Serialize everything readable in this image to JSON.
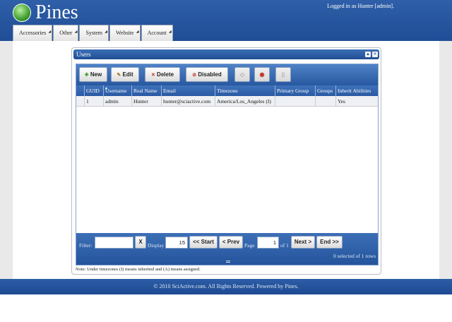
{
  "app": {
    "name": "Pines",
    "login_text": "Logged in as Hunter [admin]."
  },
  "menu": [
    {
      "label": "Accessories"
    },
    {
      "label": "Other"
    },
    {
      "label": "System"
    },
    {
      "label": "Website"
    },
    {
      "label": "Account"
    }
  ],
  "window": {
    "title": "Users"
  },
  "toolbar": {
    "new_label": "New",
    "edit_label": "Edit",
    "delete_label": "Delete",
    "disabled_label": "Disabled"
  },
  "table": {
    "columns": [
      "",
      "GUID",
      "Username",
      "Real Name",
      "Email",
      "Timezone",
      "Primary Group",
      "Groups",
      "Inherit Abilities"
    ],
    "rows": [
      [
        "",
        "1",
        "admin",
        "Hunter",
        "hunter@sciactive.com",
        "America/Los_Angeles (I)",
        "",
        "",
        "Yes"
      ]
    ]
  },
  "pager": {
    "filter_label": "Filter:",
    "filter_value": "",
    "clear_label": "X",
    "display_label": "Display",
    "display_value": "15",
    "start_label": "<< Start",
    "prev_label": "< Prev",
    "page_label": "Page",
    "page_value": "1",
    "of_label": "of 1",
    "next_label": "Next >",
    "end_label": "End >>",
    "status_text": "0 selected of 1 rows"
  },
  "note": "Note: Under timezones (I) means inherited and (A) means assigned.",
  "footer": {
    "text": "© 2010 SciActive.com. All Rights Reserved. Powered by Pines."
  },
  "colors": {
    "header_blue": "#1f4d96",
    "grid_blue": "#2858a0",
    "row_bg": "#eef0f3"
  }
}
